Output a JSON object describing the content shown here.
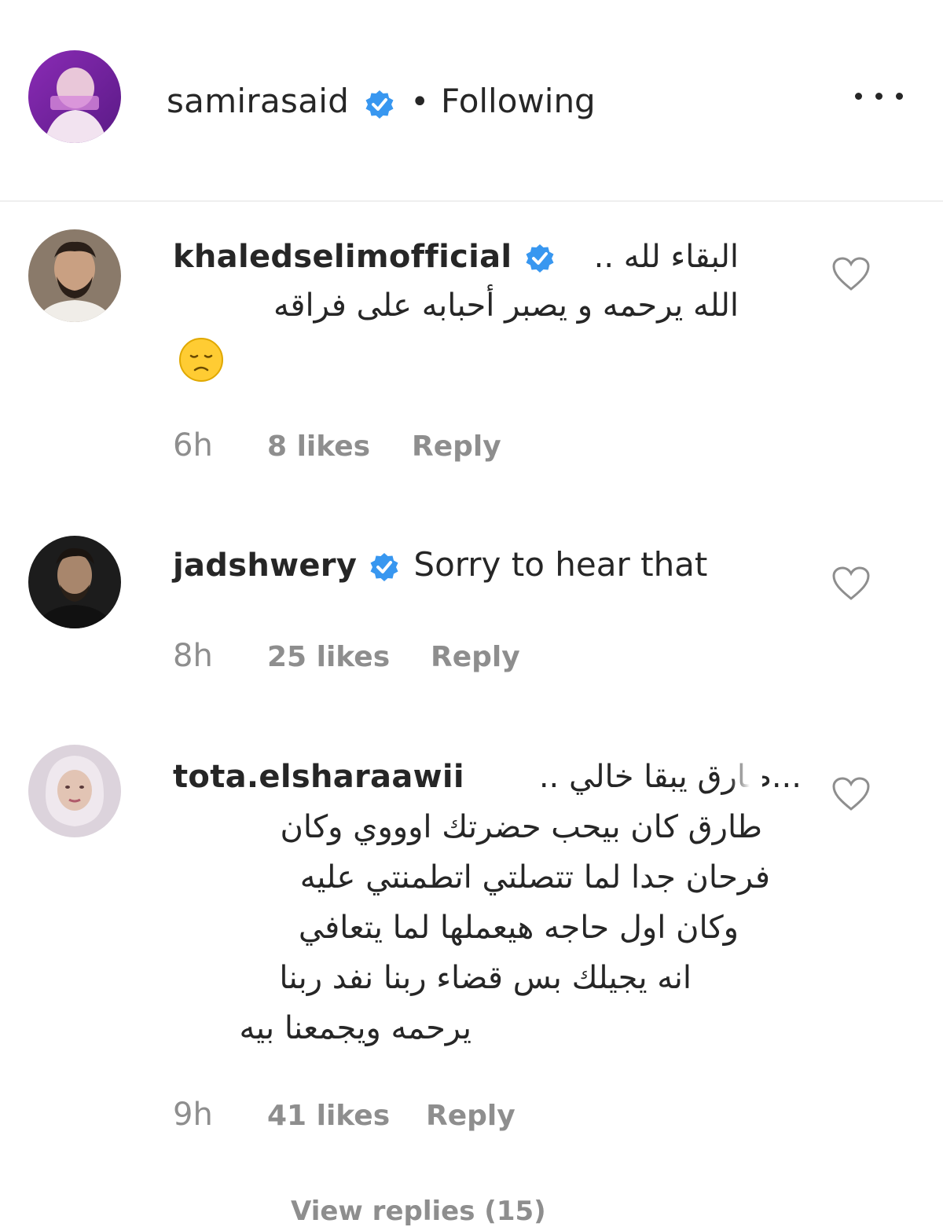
{
  "header": {
    "username": "samirasaid",
    "separator": "•",
    "follow_status": "Following",
    "more_label": "•••"
  },
  "comments": [
    {
      "username": "khaledselimofficial",
      "lines": [
        "البقاء لله ..",
        "الله يرحمه و يصبر أحبابه على فراقه"
      ],
      "emoji": "😞",
      "time": "6h",
      "likes": "8 likes",
      "reply": "Reply"
    },
    {
      "username": "jadshwery",
      "text": "Sorry to hear that",
      "time": "8h",
      "likes": "25 likes",
      "reply": "Reply"
    },
    {
      "username": "tota.elsharaawii",
      "lines": [
        "...طارق يبقا خالي ..",
        "طارق كان بيحب حضرتك اوووي وكان",
        "فرحان جدا لما تتصلتي اتطمنتي عليه",
        "وكان اول حاجه هيعملها لما يتعافي",
        "انه يجيلك بس قضاء ربنا نفد ربنا",
        "يرحمه ويجمعنا بيه"
      ],
      "time": "9h",
      "likes": "41 likes",
      "reply": "Reply",
      "view_replies": "View replies (15)"
    }
  ],
  "colors": {
    "text": "#262626",
    "muted": "#8e8e8e",
    "verified": "#3897f0",
    "divider": "#efefef"
  }
}
